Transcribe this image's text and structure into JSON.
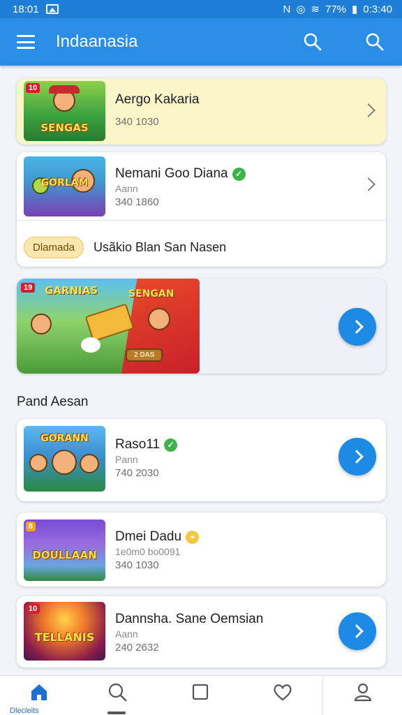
{
  "status": {
    "time": "18:01",
    "right_text": "N",
    "battery": "77%",
    "clock": "0:3:40"
  },
  "appbar": {
    "title": "Indaanasia"
  },
  "items": [
    {
      "name": "Aergo Kakaria",
      "meta": "340 1030",
      "tag": "10",
      "logo": "SENGAS"
    },
    {
      "name": "Nemani Goo Diana",
      "sub": "Aann",
      "meta": "340 1860",
      "tag": "",
      "logo": "GORLAM"
    }
  ],
  "promo": {
    "pill": "Dlamada",
    "text": "Usãkio Blan San Nasen"
  },
  "banner": {
    "tag": "19",
    "logo_left": "GARNIAS",
    "logo_right": "SENGAN",
    "cta": "2 DAS"
  },
  "section": {
    "title": "Pand Aesan"
  },
  "list": [
    {
      "name": "Raso11",
      "sub": "Pann",
      "meta": "740 2030",
      "logo": "GORANN",
      "tag": ""
    },
    {
      "name": "Dmei Dadu",
      "sub": "1e0m0 bo0091",
      "meta": "340 1030",
      "logo": "DOULLAAN",
      "tag": "8"
    },
    {
      "name": "Dannsha. Sane Oemsian",
      "sub": "Aann",
      "meta": "240 2632",
      "logo": "TELLANIS",
      "tag": "10"
    }
  ],
  "nav": {
    "home_label": "Dlecleits"
  },
  "colors": {
    "primary": "#2a8de6",
    "accent": "#1d8ae6",
    "highlight": "#fbf6c9"
  }
}
